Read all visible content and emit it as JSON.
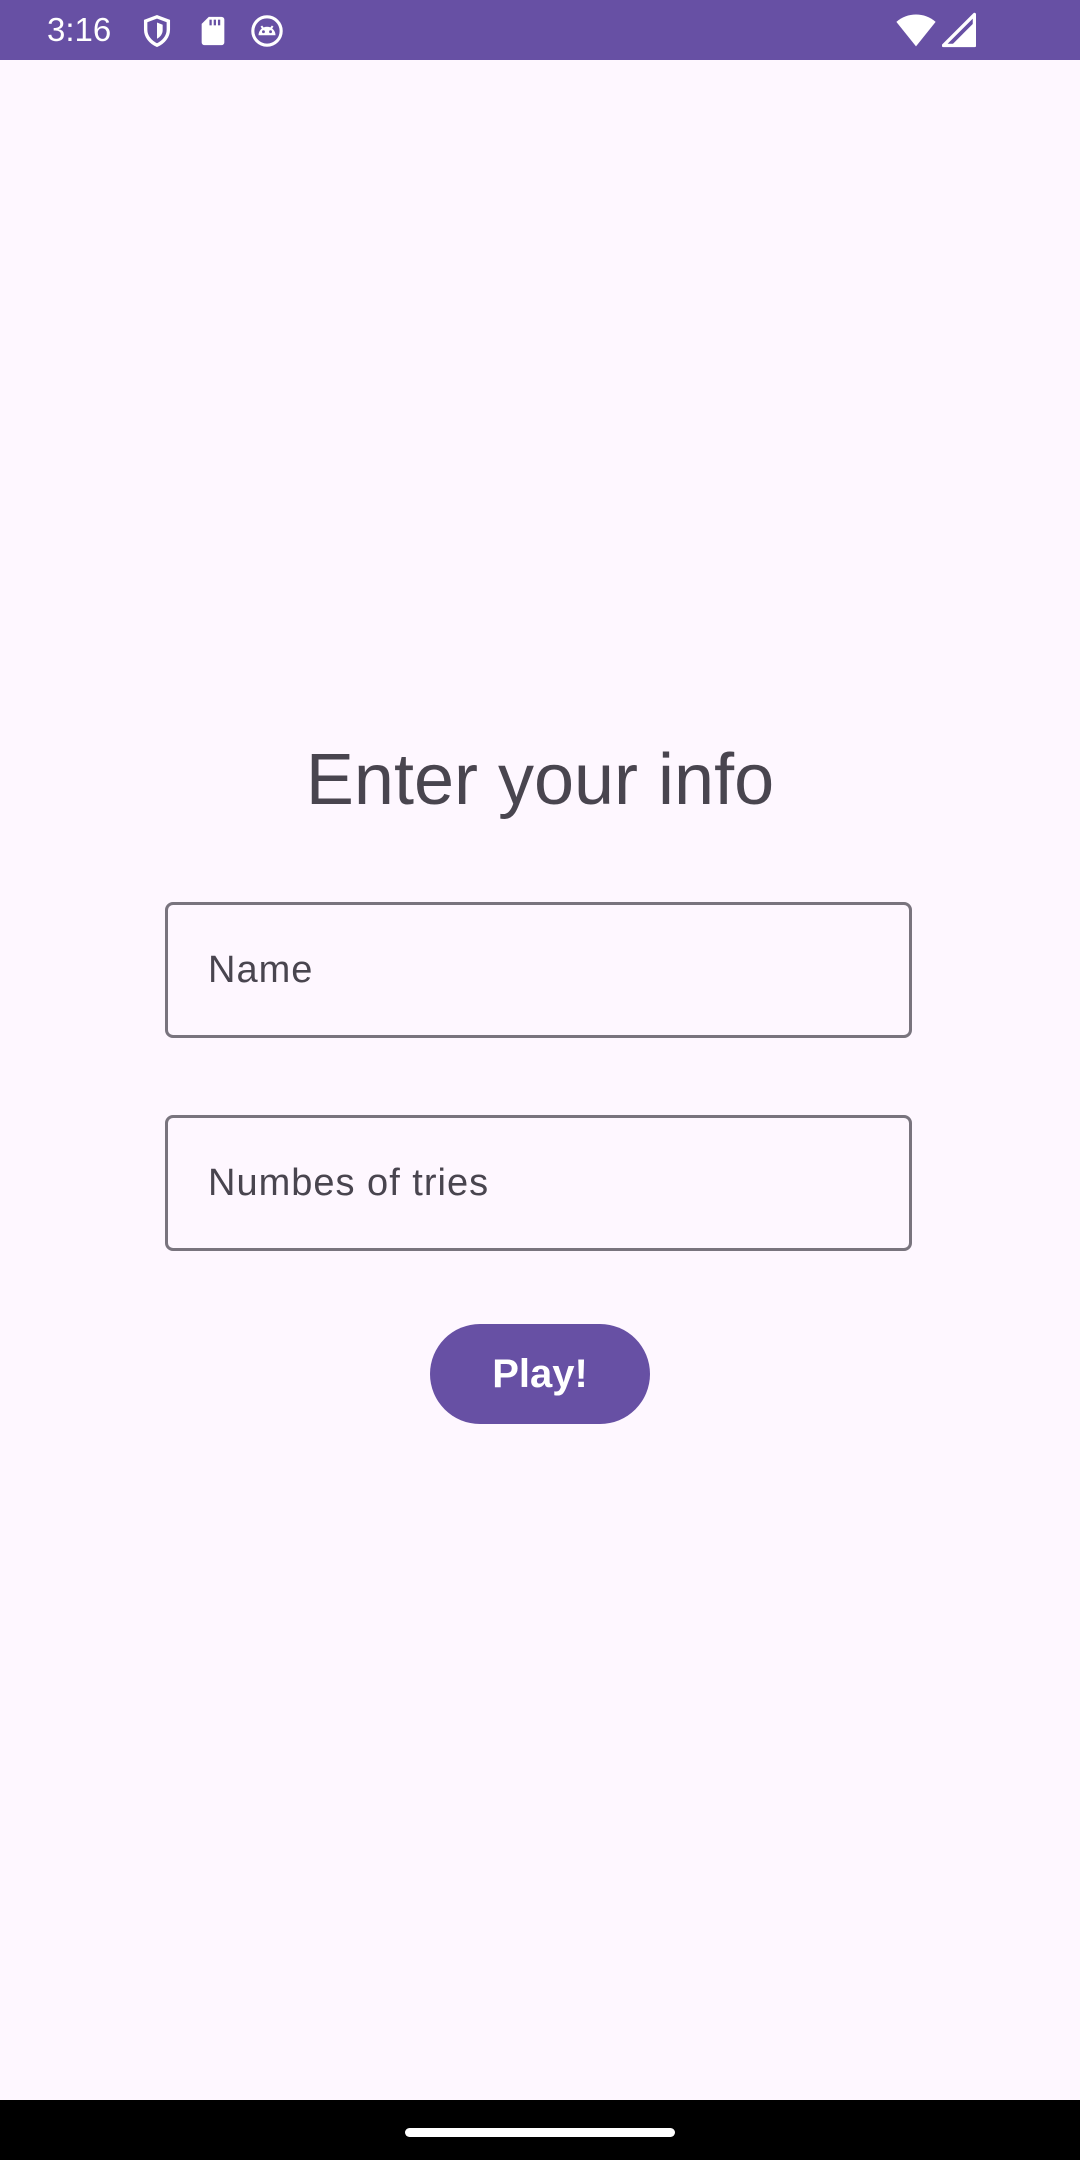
{
  "status_bar": {
    "time": "3:16",
    "left_icons": [
      "shield-icon",
      "sd-card-icon",
      "android-face-icon"
    ],
    "right_icons": [
      "wifi-icon",
      "cell-signal-icon"
    ],
    "color": "#6750A4"
  },
  "main": {
    "title": "Enter your info",
    "name_field": {
      "placeholder": "Name",
      "value": ""
    },
    "tries_field": {
      "placeholder": "Numbes of tries",
      "value": ""
    },
    "play_button": {
      "label": "Play!"
    }
  },
  "colors": {
    "background": "#FEF7FF",
    "primary": "#6750A4",
    "outline": "#79747E",
    "on_surface_variant": "#49454F"
  }
}
